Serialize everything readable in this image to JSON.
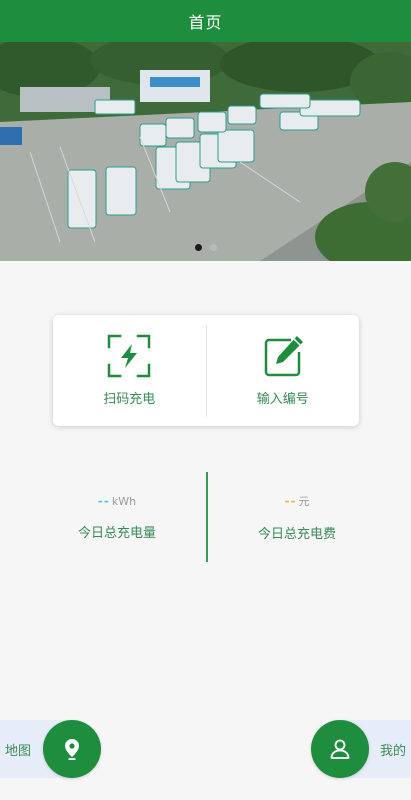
{
  "header": {
    "title": "首页"
  },
  "banner": {
    "slides": 2,
    "active_index": 0
  },
  "actions": {
    "scan_label": "扫码充电",
    "input_label": "输入编号"
  },
  "stats": {
    "energy": {
      "value": "--",
      "unit": "kWh",
      "label": "今日总充电量",
      "color": "#4fc9e0"
    },
    "fee": {
      "value": "--",
      "unit": "元",
      "label": "今日总充电费",
      "color": "#f5b942"
    }
  },
  "bottom_nav": {
    "map_label": "地图",
    "mine_label": "我的"
  },
  "colors": {
    "brand": "#1e8e3e",
    "accent_text": "#3a8a55"
  }
}
